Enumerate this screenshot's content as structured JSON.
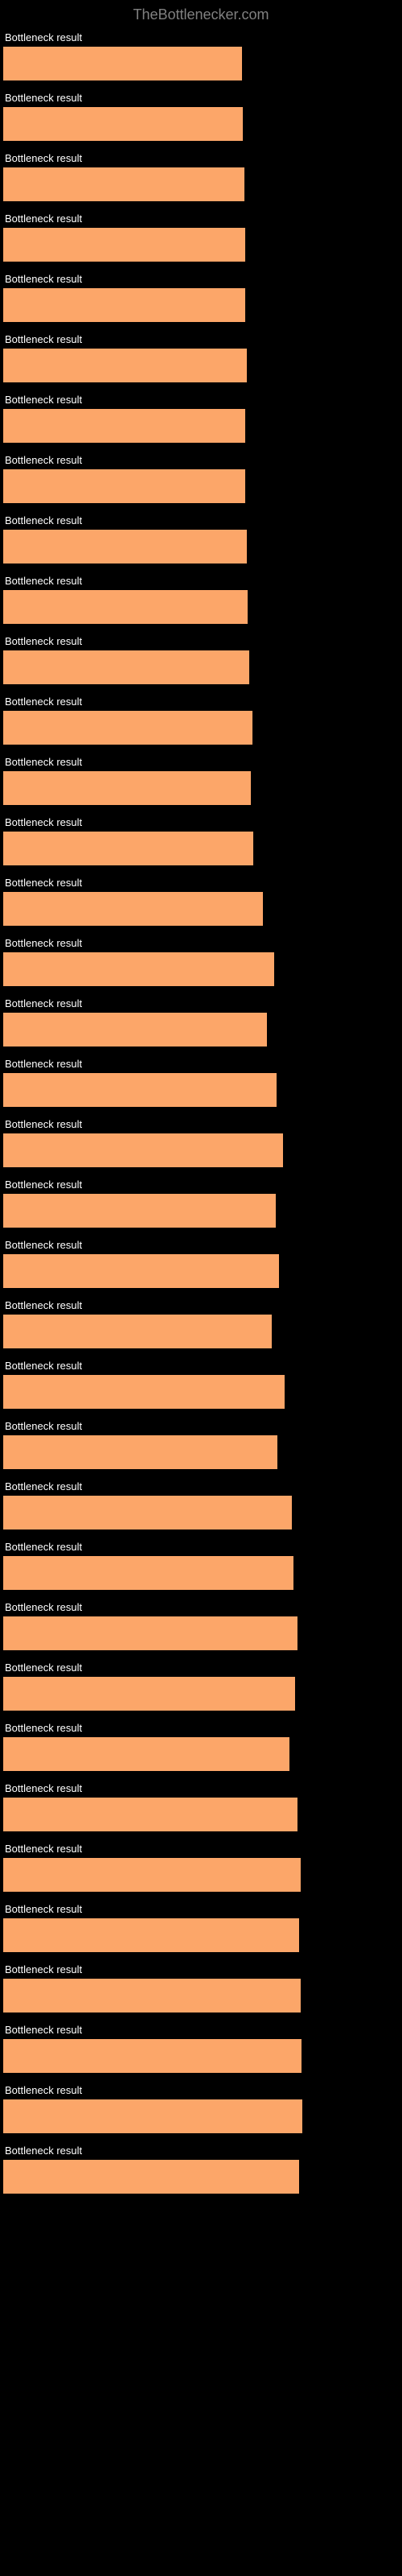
{
  "header": {
    "title": "TheBottlenecker.com"
  },
  "chart_data": {
    "type": "bar",
    "title": "TheBottlenecker.com",
    "xlabel": "",
    "ylabel": "Bottleneck result",
    "xlim": [
      0,
      100
    ],
    "bar_color": "#fca669",
    "background": "#000000",
    "series": [
      {
        "label": "Bottleneck result",
        "value": 63.2
      },
      {
        "label": "Bottleneck result",
        "value": 63.4
      },
      {
        "label": "Bottleneck result",
        "value": 63.8
      },
      {
        "label": "Bottleneck result",
        "value": 64.1
      },
      {
        "label": "Bottleneck result",
        "value": 64.0
      },
      {
        "label": "Bottleneck result",
        "value": 64.5
      },
      {
        "label": "Bottleneck result",
        "value": 64.1
      },
      {
        "label": "Bottleneck result",
        "value": 64.1
      },
      {
        "label": "Bottleneck result",
        "value": 64.5
      },
      {
        "label": "Bottleneck result",
        "value": 64.7
      },
      {
        "label": "Bottleneck result",
        "value": 65.2
      },
      {
        "label": "Bottleneck result",
        "value": 66.0
      },
      {
        "label": "Bottleneck result",
        "value": 65.6
      },
      {
        "label": "Bottleneck result",
        "value": 66.1
      },
      {
        "label": "Bottleneck result",
        "value": 68.8
      },
      {
        "label": "Bottleneck result",
        "value": 71.6
      },
      {
        "label": "Bottleneck result",
        "value": 69.7
      },
      {
        "label": "Bottleneck result",
        "value": 72.4
      },
      {
        "label": "Bottleneck result",
        "value": 74.0
      },
      {
        "label": "Bottleneck result",
        "value": 72.2
      },
      {
        "label": "Bottleneck result",
        "value": 73.0
      },
      {
        "label": "Bottleneck result",
        "value": 71.1
      },
      {
        "label": "Bottleneck result",
        "value": 74.4
      },
      {
        "label": "Bottleneck result",
        "value": 72.6
      },
      {
        "label": "Bottleneck result",
        "value": 76.3
      },
      {
        "label": "Bottleneck result",
        "value": 76.8
      },
      {
        "label": "Bottleneck result",
        "value": 77.9
      },
      {
        "label": "Bottleneck result",
        "value": 77.2
      },
      {
        "label": "Bottleneck result",
        "value": 75.8
      },
      {
        "label": "Bottleneck result",
        "value": 77.8
      },
      {
        "label": "Bottleneck result",
        "value": 78.7
      },
      {
        "label": "Bottleneck result",
        "value": 78.4
      },
      {
        "label": "Bottleneck result",
        "value": 78.8
      },
      {
        "label": "Bottleneck result",
        "value": 79.0
      },
      {
        "label": "Bottleneck result",
        "value": 79.2
      },
      {
        "label": "Bottleneck result",
        "value": 78.3
      }
    ]
  }
}
